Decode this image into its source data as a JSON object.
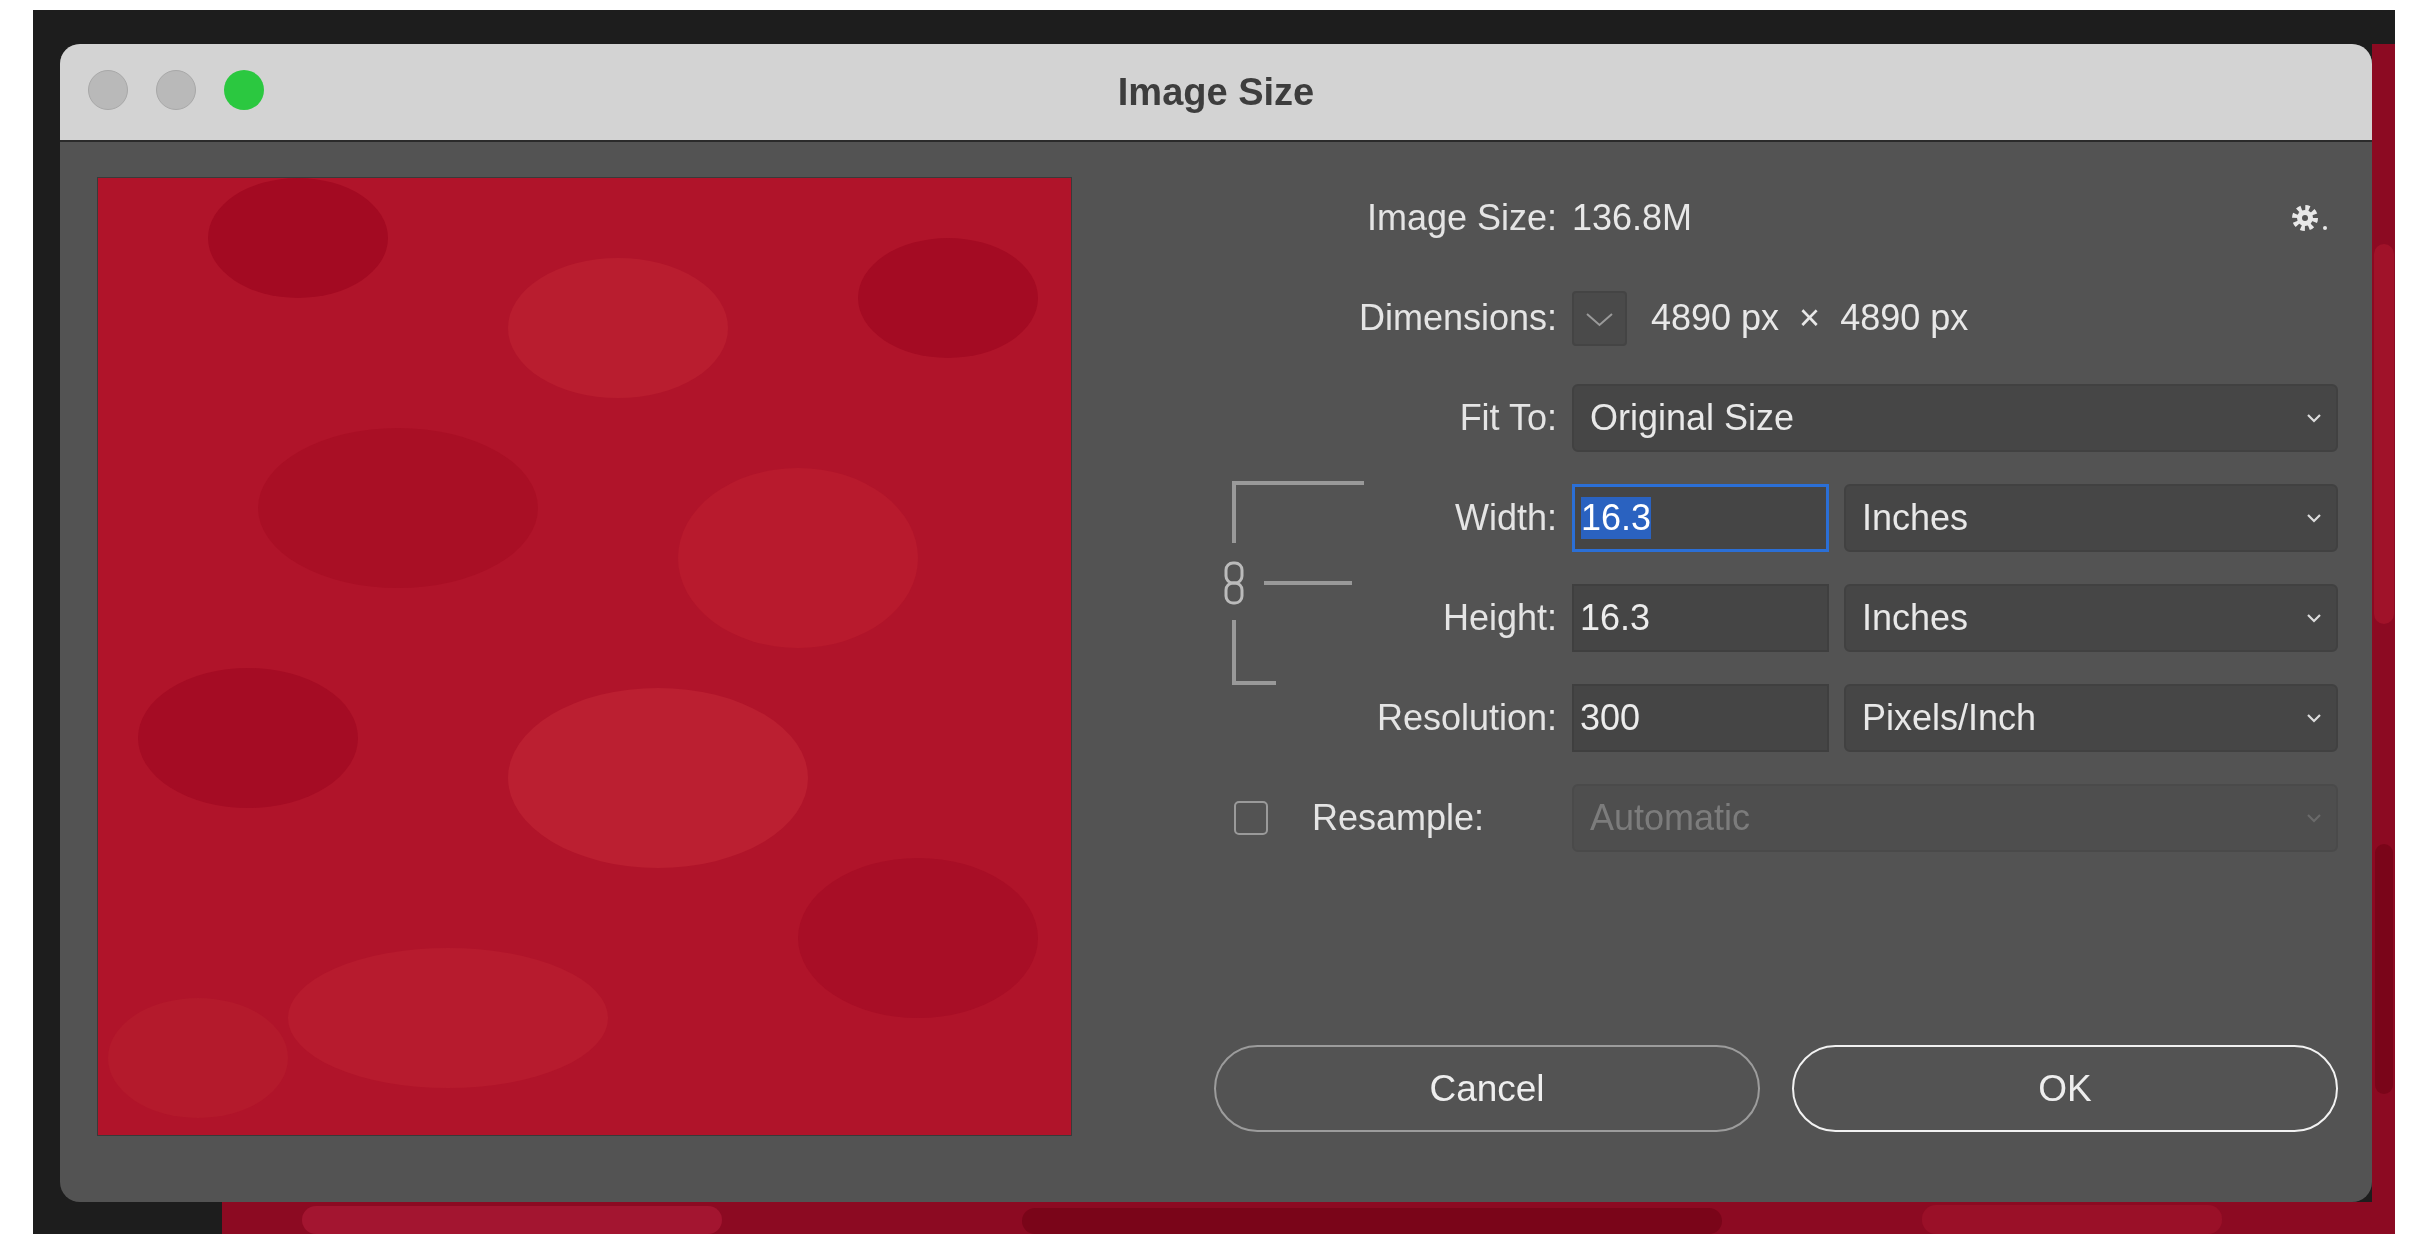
{
  "window": {
    "title": "Image Size"
  },
  "image_size": {
    "label": "Image Size:",
    "value": "136.8M"
  },
  "dimensions": {
    "label": "Dimensions:",
    "value": "4890 px  ×  4890 px"
  },
  "fit_to": {
    "label": "Fit To:",
    "value": "Original Size"
  },
  "size_fields": [
    {
      "label": "Width:",
      "value": "16.3",
      "unit": "Inches",
      "selected": true
    },
    {
      "label": "Height:",
      "value": "16.3",
      "unit": "Inches",
      "selected": false
    },
    {
      "label": "Resolution:",
      "value": "300",
      "unit": "Pixels/Inch",
      "selected": false
    }
  ],
  "resample": {
    "label": "Resample:",
    "checked": false,
    "value": "Automatic",
    "disabled": true
  },
  "buttons": [
    {
      "label": "Cancel",
      "default": false
    },
    {
      "label": "OK",
      "default": true
    }
  ]
}
